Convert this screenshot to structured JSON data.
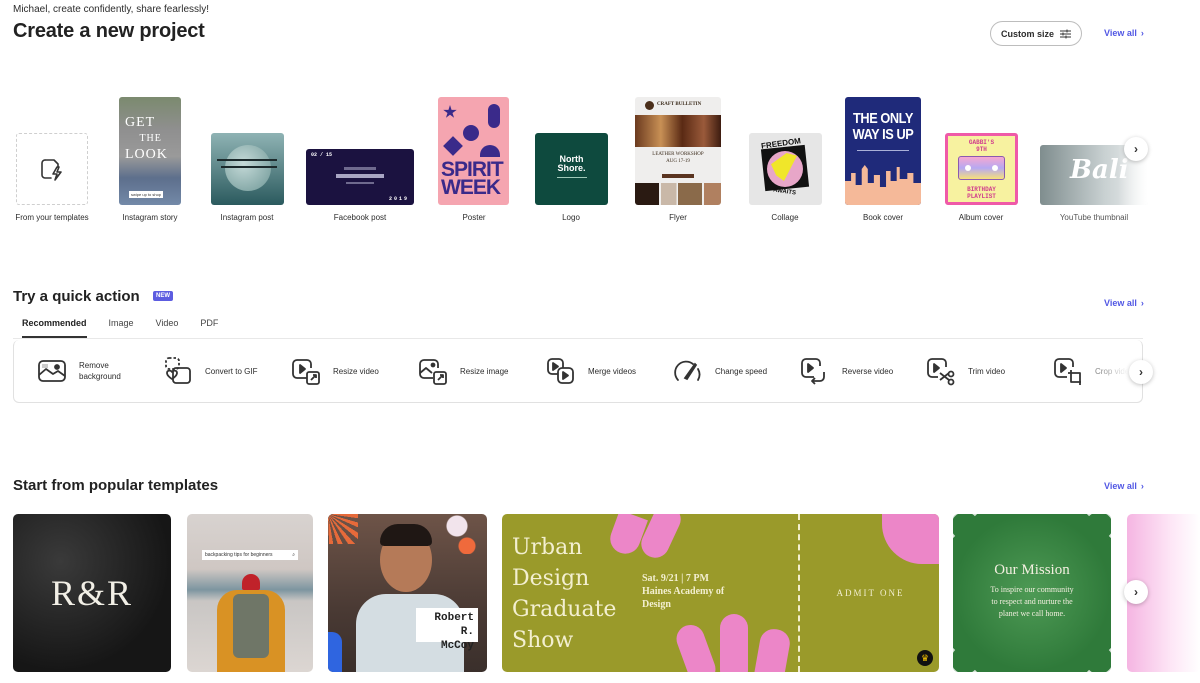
{
  "header": {
    "greeting": "Michael, create confidently, share fearlessly!",
    "title": "Create a new project",
    "custom_size_label": "Custom size",
    "view_all": "View all"
  },
  "create_items": [
    {
      "label": "From your templates"
    },
    {
      "label": "Instagram story",
      "thumb_text": [
        "GET",
        "THE",
        "LOOK"
      ],
      "thumb_caption": "swipe up to shop"
    },
    {
      "label": "Instagram post"
    },
    {
      "label": "Facebook post",
      "thumb_date": "02 / 15",
      "thumb_year": "2019"
    },
    {
      "label": "Poster",
      "thumb_text": [
        "SPIRIT",
        "WEEK"
      ]
    },
    {
      "label": "Logo",
      "thumb_text": [
        "North",
        "Shore."
      ]
    },
    {
      "label": "Flyer",
      "thumb_header": "CRAFT BULLETIN",
      "thumb_title": "LEATHER WORKSHOP",
      "thumb_date": "AUG 17-19"
    },
    {
      "label": "Collage",
      "thumb_text": [
        "FREEDOM",
        "AWAITS"
      ]
    },
    {
      "label": "Book cover",
      "thumb_text": [
        "THE ONLY",
        "WAY IS UP"
      ]
    },
    {
      "label": "Album cover",
      "thumb_text": [
        "GABBI'S",
        "9TH",
        "BIRTHDAY",
        "PLAYLIST"
      ]
    },
    {
      "label": "YouTube thumbnail",
      "thumb_text": "Bali"
    }
  ],
  "quick_action": {
    "title": "Try a quick action",
    "badge": "NEW",
    "view_all": "View all",
    "tabs": [
      {
        "label": "Recommended",
        "active": true
      },
      {
        "label": "Image",
        "active": false
      },
      {
        "label": "Video",
        "active": false
      },
      {
        "label": "PDF",
        "active": false
      }
    ],
    "actions": [
      {
        "label_lines": [
          "Remove",
          "background"
        ],
        "icon": "remove-background-icon"
      },
      {
        "label_lines": [
          "Convert to GIF"
        ],
        "icon": "convert-gif-icon"
      },
      {
        "label_lines": [
          "Resize video"
        ],
        "icon": "resize-video-icon"
      },
      {
        "label_lines": [
          "Resize image"
        ],
        "icon": "resize-image-icon"
      },
      {
        "label_lines": [
          "Merge videos"
        ],
        "icon": "merge-videos-icon"
      },
      {
        "label_lines": [
          "Change speed"
        ],
        "icon": "change-speed-icon"
      },
      {
        "label_lines": [
          "Reverse video"
        ],
        "icon": "reverse-video-icon"
      },
      {
        "label_lines": [
          "Trim video"
        ],
        "icon": "trim-video-icon"
      },
      {
        "label_lines": [
          "Crop video"
        ],
        "icon": "crop-video-icon"
      }
    ]
  },
  "popular": {
    "title": "Start from popular templates",
    "view_all": "View all",
    "templates": [
      {
        "text": "R&R"
      },
      {
        "text": "backpacking tips for beginners"
      },
      {
        "text_lines": [
          "Robert R.",
          "McCoy"
        ]
      },
      {
        "title_lines": [
          "Urban",
          "Design",
          "Graduate",
          "Show"
        ],
        "details": [
          "Sat. 9/21 | 7 PM",
          "Haines Academy of",
          "Design"
        ],
        "stub": "ADMIT ONE"
      },
      {
        "title": "Our Mission",
        "body": [
          "To inspire our community",
          "to respect and nurture the",
          "planet we call home."
        ]
      },
      {}
    ]
  },
  "colors": {
    "accent": "#5258e4",
    "badge": "#5c5ce0",
    "olive": "#9a9a2a",
    "pink": "#ec86c8",
    "green": "#2e7d3a",
    "navy": "#1f2a7a"
  }
}
